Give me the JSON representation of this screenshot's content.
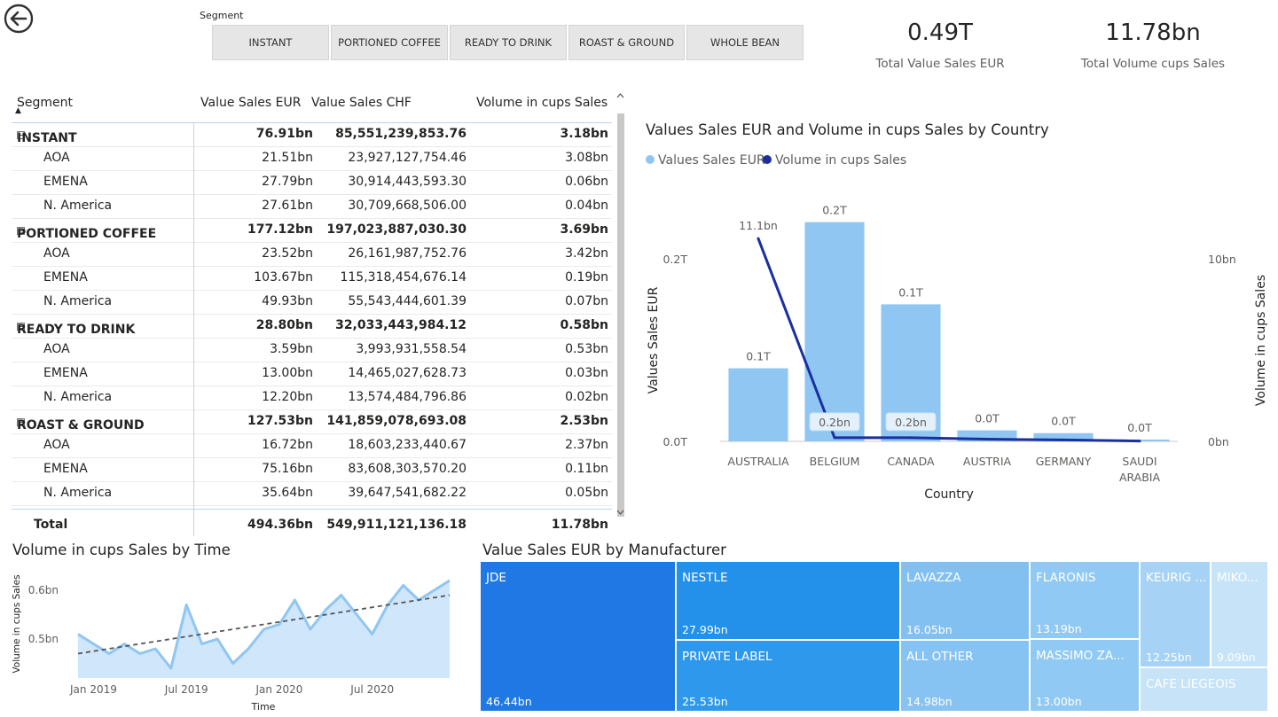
{
  "slicer": {
    "title": "Segment",
    "options": [
      "INSTANT",
      "PORTIONED COFFEE",
      "READY TO DRINK",
      "ROAST & GROUND",
      "WHOLE BEAN"
    ]
  },
  "cards": [
    {
      "value": "0.49T",
      "label": "Total Value Sales EUR"
    },
    {
      "value": "11.78bn",
      "label": "Total Volume cups Sales"
    }
  ],
  "matrix": {
    "headers": [
      "Segment",
      "Value Sales EUR",
      "Value Sales CHF",
      "Volume in cups Sales"
    ],
    "groups": [
      {
        "name": "INSTANT",
        "eur": "76.91bn",
        "chf": "85,551,239,853.76",
        "vol": "3.18bn",
        "rows": [
          {
            "name": "AOA",
            "eur": "21.51bn",
            "chf": "23,927,127,754.46",
            "vol": "3.08bn"
          },
          {
            "name": "EMENA",
            "eur": "27.79bn",
            "chf": "30,914,443,593.30",
            "vol": "0.06bn"
          },
          {
            "name": "N. America",
            "eur": "27.61bn",
            "chf": "30,709,668,506.00",
            "vol": "0.04bn"
          }
        ]
      },
      {
        "name": "PORTIONED COFFEE",
        "eur": "177.12bn",
        "chf": "197,023,887,030.30",
        "vol": "3.69bn",
        "rows": [
          {
            "name": "AOA",
            "eur": "23.52bn",
            "chf": "26,161,987,752.76",
            "vol": "3.42bn"
          },
          {
            "name": "EMENA",
            "eur": "103.67bn",
            "chf": "115,318,454,676.14",
            "vol": "0.19bn"
          },
          {
            "name": "N. America",
            "eur": "49.93bn",
            "chf": "55,543,444,601.39",
            "vol": "0.07bn"
          }
        ]
      },
      {
        "name": "READY TO DRINK",
        "eur": "28.80bn",
        "chf": "32,033,443,984.12",
        "vol": "0.58bn",
        "rows": [
          {
            "name": "AOA",
            "eur": "3.59bn",
            "chf": "3,993,931,558.54",
            "vol": "0.53bn"
          },
          {
            "name": "EMENA",
            "eur": "13.00bn",
            "chf": "14,465,027,628.73",
            "vol": "0.03bn"
          },
          {
            "name": "N. America",
            "eur": "12.20bn",
            "chf": "13,574,484,796.86",
            "vol": "0.02bn"
          }
        ]
      },
      {
        "name": "ROAST & GROUND",
        "eur": "127.53bn",
        "chf": "141,859,078,693.08",
        "vol": "2.53bn",
        "rows": [
          {
            "name": "AOA",
            "eur": "16.72bn",
            "chf": "18,603,233,440.67",
            "vol": "2.37bn"
          },
          {
            "name": "EMENA",
            "eur": "75.16bn",
            "chf": "83,608,303,570.20",
            "vol": "0.11bn"
          },
          {
            "name": "N. America",
            "eur": "35.64bn",
            "chf": "39,647,541,682.22",
            "vol": "0.05bn"
          }
        ]
      }
    ],
    "total": {
      "name": "Total",
      "eur": "494.36bn",
      "chf": "549,911,121,136.18",
      "vol": "11.78bn"
    }
  },
  "combo_chart": {
    "title": "Values Sales EUR and Volume in cups Sales by Country",
    "chart_data": {
      "type": "bar",
      "categories": [
        "AUSTRALIA",
        "BELGIUM",
        "CANADA",
        "AUSTRIA",
        "GERMANY",
        "SAUDI ARABIA"
      ],
      "series": [
        {
          "name": "Values Sales EUR",
          "type": "bar",
          "axis": "left",
          "values": [
            0.08,
            0.24,
            0.15,
            0.012,
            0.009,
            0.002
          ],
          "labels": [
            "0.1T",
            "0.2T",
            "0.1T",
            "0.0T",
            "0.0T",
            "0.0T"
          ],
          "color": "#8fc6f2"
        },
        {
          "name": "Volume in cups Sales",
          "type": "line",
          "axis": "right",
          "values": [
            11.1,
            0.2,
            0.2,
            0.12,
            0.08,
            0.02
          ],
          "labels": [
            "11.1bn",
            "0.2bn",
            "0.2bn",
            "",
            "",
            ""
          ],
          "color": "#1a2fa0"
        }
      ],
      "xlabel": "Country",
      "ylabel": "Values Sales EUR",
      "y2label": "Volume in cups Sales",
      "ylim": [
        0,
        0.26
      ],
      "y2lim": [
        0,
        13
      ],
      "yticks": [
        "0.0T",
        "0.2T"
      ],
      "y2ticks": [
        "0bn",
        "10bn"
      ],
      "legend": "top-left"
    }
  },
  "time_chart": {
    "title": "Volume in cups Sales by Time",
    "chart_data": {
      "type": "area",
      "x": [
        "2018-12",
        "2019-01",
        "2019-02",
        "2019-03",
        "2019-04",
        "2019-05",
        "2019-06",
        "2019-07",
        "2019-08",
        "2019-09",
        "2019-10",
        "2019-11",
        "2019-12",
        "2020-01",
        "2020-02",
        "2020-03",
        "2020-04",
        "2020-05",
        "2020-06",
        "2020-07",
        "2020-08",
        "2020-09",
        "2020-10",
        "2020-11",
        "2020-12"
      ],
      "values": [
        0.51,
        0.49,
        0.47,
        0.49,
        0.47,
        0.48,
        0.44,
        0.57,
        0.49,
        0.5,
        0.45,
        0.48,
        0.52,
        0.53,
        0.58,
        0.52,
        0.56,
        0.59,
        0.55,
        0.51,
        0.57,
        0.61,
        0.58,
        0.6,
        0.62
      ],
      "trend": [
        0.47,
        0.59
      ],
      "xlabel": "Time",
      "ylabel": "Volume in cups Sales",
      "xticks": [
        "Jan 2019",
        "Jul 2019",
        "Jan 2020",
        "Jul 2020"
      ],
      "yticks": [
        "0.5bn",
        "0.6bn"
      ],
      "ylim": [
        0.42,
        0.64
      ],
      "color": "#8fc6f2"
    }
  },
  "treemap": {
    "title": "Value Sales EUR by Manufacturer",
    "chart_data": {
      "type": "treemap",
      "items": [
        {
          "name": "JDE",
          "value": 46.44,
          "label": "46.44bn",
          "color": "#2078e4"
        },
        {
          "name": "NESTLE",
          "value": 27.99,
          "label": "27.99bn",
          "color": "#2390ea"
        },
        {
          "name": "PRIVATE LABEL",
          "value": 25.53,
          "label": "25.53bn",
          "color": "#2e99ec"
        },
        {
          "name": "LAVAZZA",
          "value": 16.05,
          "label": "16.05bn",
          "color": "#83c0f2"
        },
        {
          "name": "ALL OTHER",
          "value": 14.98,
          "label": "14.98bn",
          "color": "#86c3f3"
        },
        {
          "name": "FLARONIS",
          "value": 13.19,
          "label": "13.19bn",
          "color": "#90c9f3"
        },
        {
          "name": "MASSIMO ZA...",
          "value": 13.0,
          "label": "13.00bn",
          "color": "#90c9f3"
        },
        {
          "name": "KEURIG ...",
          "value": 12.25,
          "label": "12.25bn",
          "color": "#a6d3f5"
        },
        {
          "name": "MIKO...",
          "value": 9.09,
          "label": "9.09bn",
          "color": "#c6e3f8"
        },
        {
          "name": "CAFE LIEGEOIS",
          "value": 0,
          "label": "",
          "color": "#c6e3f8"
        }
      ]
    }
  }
}
